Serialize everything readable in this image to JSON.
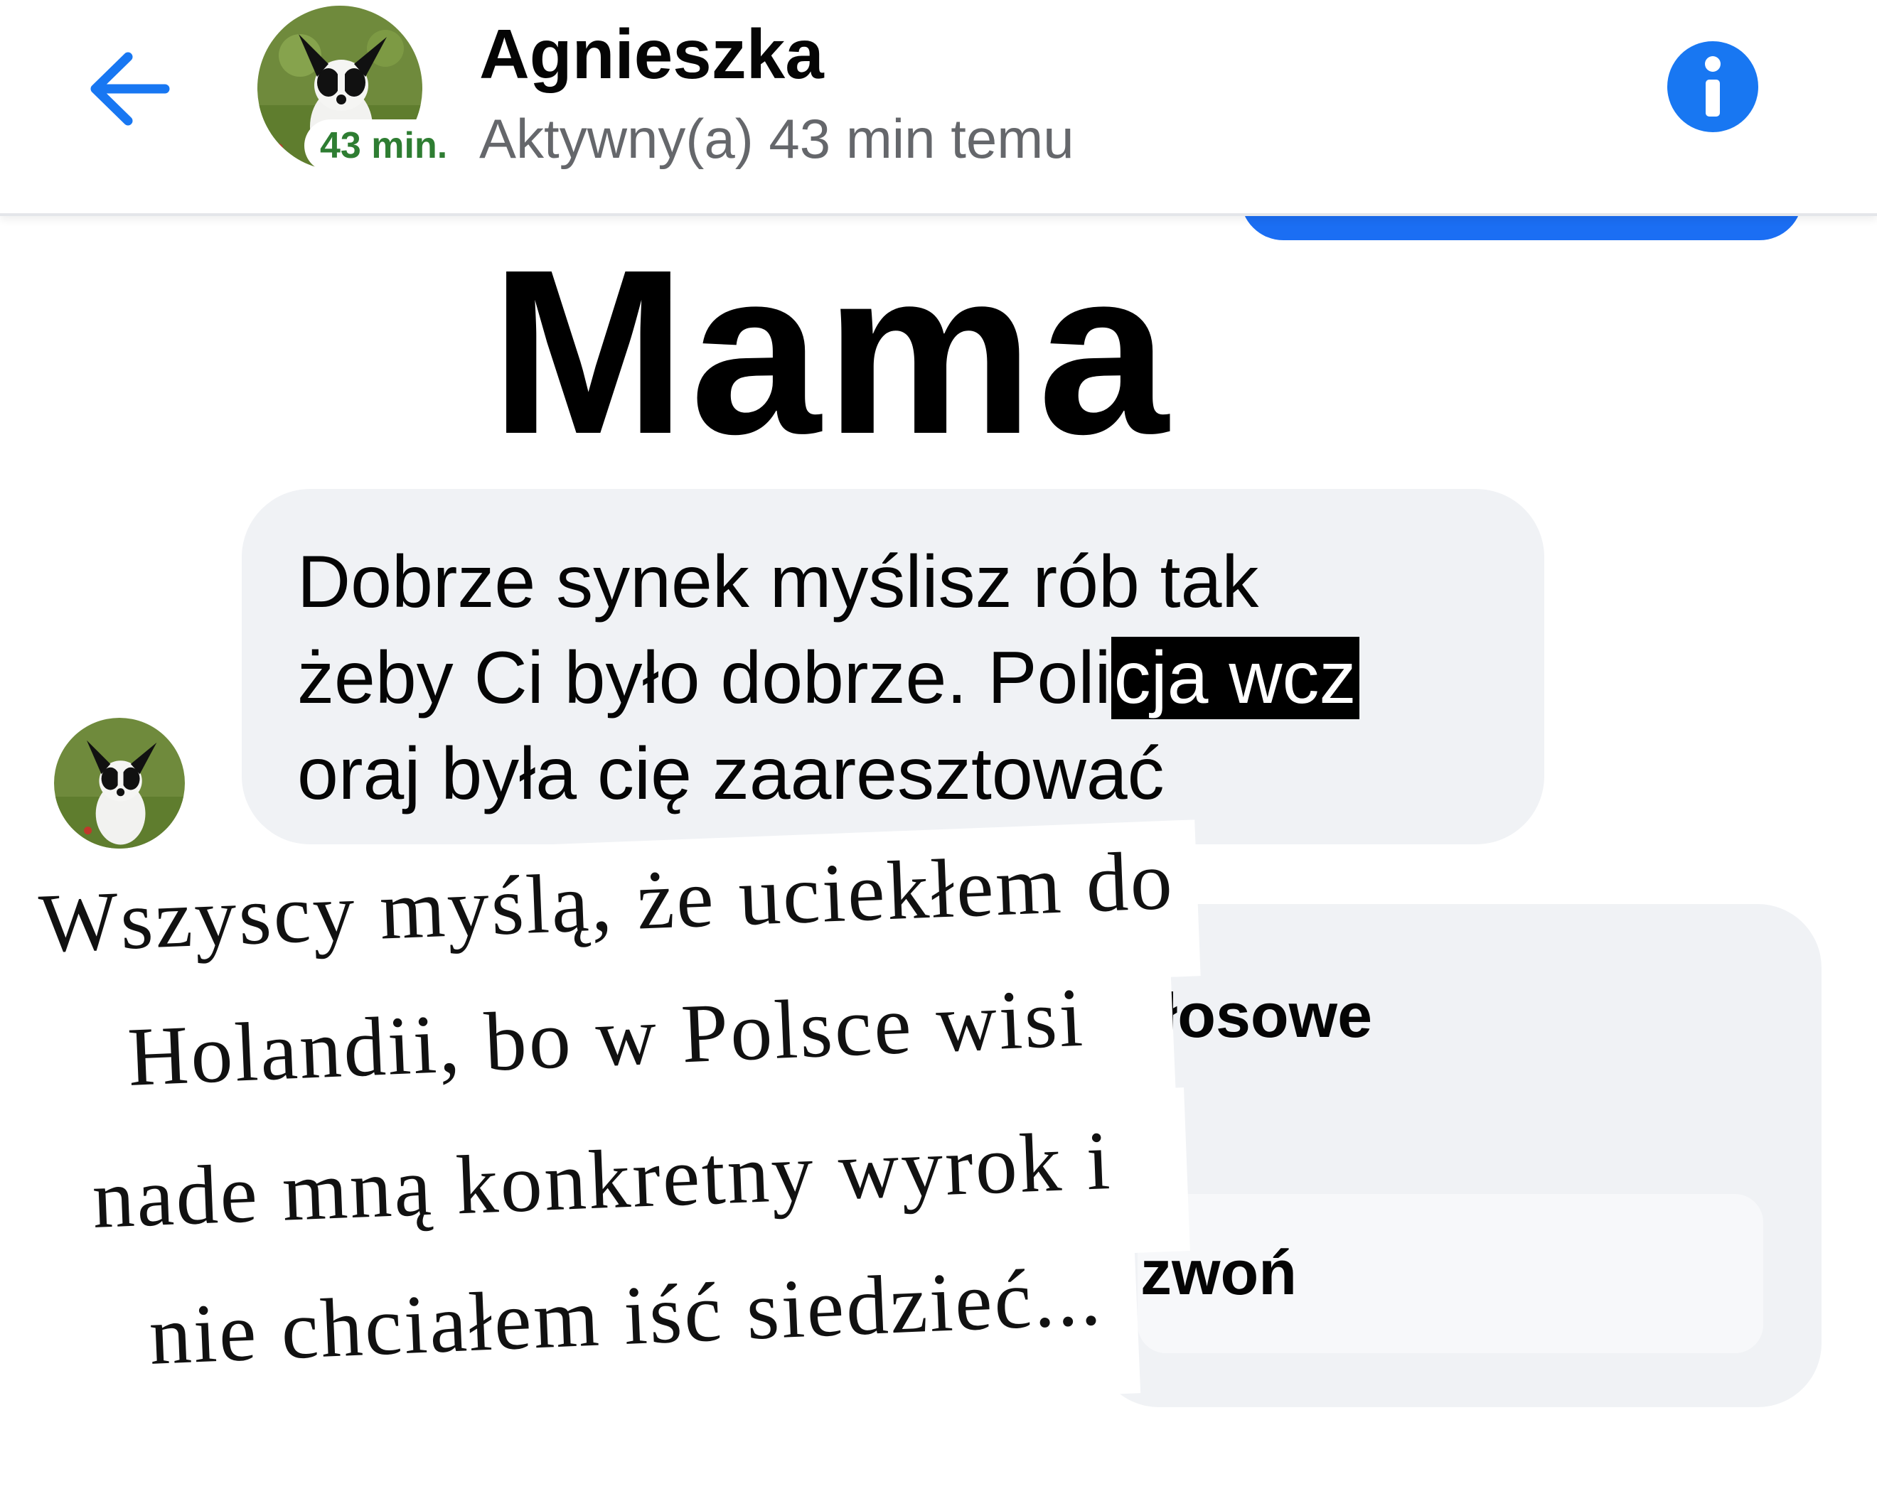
{
  "header": {
    "back_label": "Wstecz",
    "contact_name": "Agnieszka",
    "active_badge": "43 min.",
    "status": "Aktywny(a) 43 min temu",
    "accent_color": "#1877f2"
  },
  "overlay_title": "Mama",
  "message": {
    "line1": "Dobrze synek myślisz rób tak",
    "line2_prefix": "żeby  Ci było  dobrze. Poli",
    "line2_highlight": "cja wcz",
    "line3": "oraj była cię zaaresztować"
  },
  "covered_bubble": {
    "option1": "głosowe",
    "option2": "zwoń"
  },
  "caption": {
    "line1": "Wszyscy myślą, że uciekłem do",
    "line2": "Holandii, bo w Polsce wisi",
    "line3": "nade mną konkretny wyrok i",
    "line4": "nie chciałem iść siedzieć..."
  },
  "icons": {
    "back": "arrow-left-icon",
    "info": "info-icon"
  }
}
